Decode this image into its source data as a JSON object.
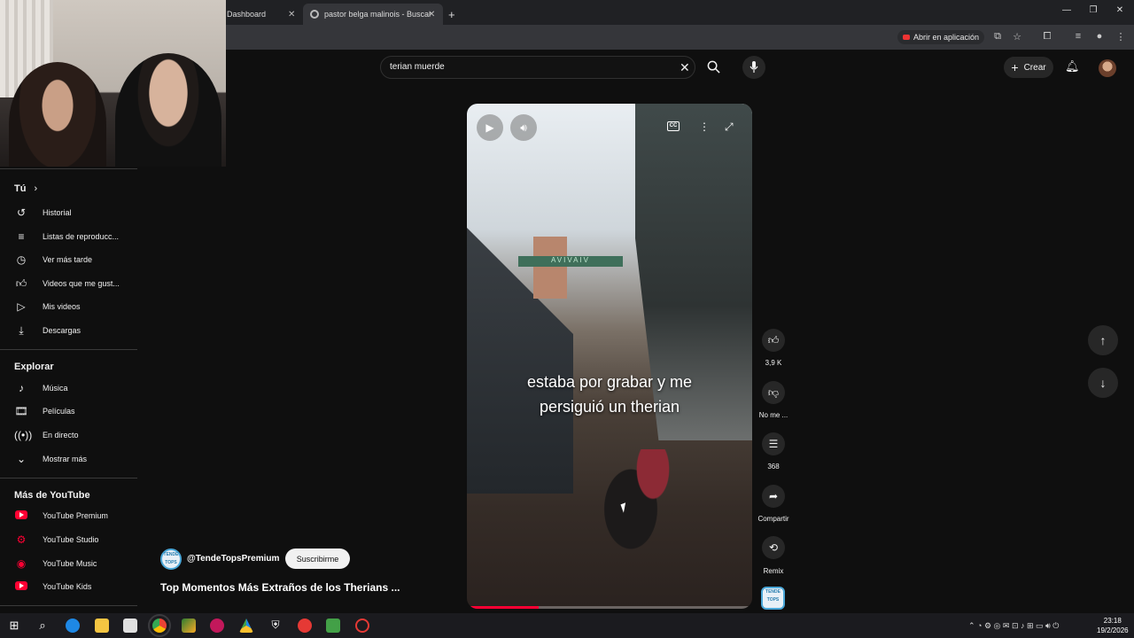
{
  "browser": {
    "tabs": [
      {
        "label": "Dashboard"
      },
      {
        "label": "pastor belga malinois - Buscar"
      }
    ],
    "open_in_app": "Abrir en aplicación"
  },
  "masthead": {
    "search_value": "terian muerde",
    "create_label": "Crear"
  },
  "sidebar": {
    "you_heading": "Tú",
    "you_items": [
      {
        "label": "Historial",
        "icon": "history-icon"
      },
      {
        "label": "Listas de reproducc...",
        "icon": "playlist-icon"
      },
      {
        "label": "Ver más tarde",
        "icon": "clock-icon"
      },
      {
        "label": "Videos que me gust...",
        "icon": "thumb-up-icon"
      },
      {
        "label": "Mis videos",
        "icon": "video-icon"
      },
      {
        "label": "Descargas",
        "icon": "download-icon"
      }
    ],
    "explore_heading": "Explorar",
    "explore_items": [
      {
        "label": "Música",
        "icon": "music-icon"
      },
      {
        "label": "Películas",
        "icon": "film-icon"
      },
      {
        "label": "En directo",
        "icon": "live-icon"
      },
      {
        "label": "Mostrar más",
        "icon": "chevron-down-icon"
      }
    ],
    "more_heading": "Más de YouTube",
    "more_items": [
      {
        "label": "YouTube Premium"
      },
      {
        "label": "YouTube Studio"
      },
      {
        "label": "YouTube Music"
      },
      {
        "label": "YouTube Kids"
      }
    ]
  },
  "short": {
    "caption_line1": "estaba por grabar y me",
    "caption_line2": "persiguió un therian",
    "sign_text": "AVIVAIV",
    "cc_label": "CC",
    "progress": 0.25,
    "channel_badge": "TENDE TOPS",
    "channel": "@TendeTopsPremium",
    "subscribe_label": "Suscribirme",
    "title": "Top Momentos Más Extraños de los Therians ..."
  },
  "actions": {
    "likes": "3,9 K",
    "dislike_label": "No me ...",
    "comments": "368",
    "share_label": "Compartir",
    "remix_label": "Remix"
  },
  "taskbar": {
    "time": "23:18",
    "date": "19/2/2026"
  },
  "colors": {
    "background": "#0f0f0f",
    "youtube_red": "#ff0033",
    "button_gray": "#272727"
  }
}
